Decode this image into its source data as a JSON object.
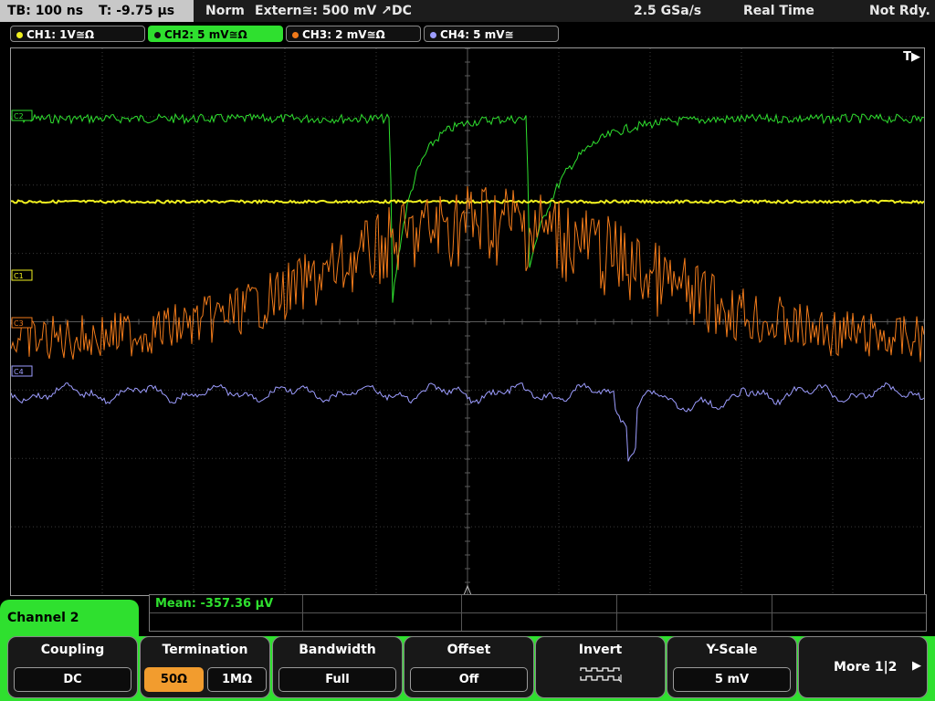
{
  "status_bar": {
    "timebase": "TB: 100 ns",
    "trigger_time": "T: -9.75 µs",
    "trigger_mode": "Norm",
    "trigger_source": "Extern≅: 500 mV ↗DC",
    "sample_rate": "2.5 GSa/s",
    "acq_mode": "Real Time",
    "acq_state": "Not Rdy."
  },
  "channels": [
    {
      "label": "CH1: 1V≅Ω",
      "color": "#f0f020",
      "active": false
    },
    {
      "label": "CH2: 5 mV≅Ω",
      "color": "#2fe02f",
      "active": true
    },
    {
      "label": "CH3: 2 mV≅Ω",
      "color": "#f07a1a",
      "active": false
    },
    {
      "label": "CH4: 5 mV≅",
      "color": "#9d9dff",
      "active": false
    }
  ],
  "trace_markers": {
    "c1": "C1",
    "c2": "C2",
    "c3": "C3",
    "c4": "C4"
  },
  "trigger_marker": "T▶",
  "measurement": {
    "label": "Mean:",
    "value": "-357.36 µV"
  },
  "channel_panel": {
    "title": "Channel 2"
  },
  "softkeys": {
    "coupling": {
      "title": "Coupling",
      "value": "DC"
    },
    "termination": {
      "title": "Termination",
      "option_a": "50Ω",
      "option_b": "1MΩ",
      "selected": "50Ω"
    },
    "bandwidth": {
      "title": "Bandwidth",
      "value": "Full"
    },
    "offset": {
      "title": "Offset",
      "value": "Off"
    },
    "invert": {
      "title": "Invert",
      "icon": "invert-waveform-icon"
    },
    "yscale": {
      "title": "Y-Scale",
      "value": "5 mV"
    },
    "more": {
      "label": "More 1|2"
    }
  }
}
